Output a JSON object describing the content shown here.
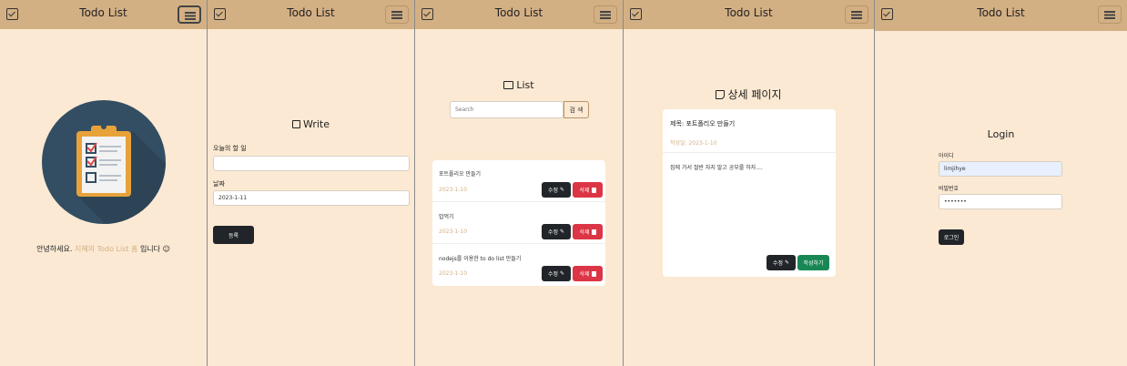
{
  "app_title": "Todo List",
  "home": {
    "greeting_prefix": "안녕하세요. ",
    "greeting_name": "지혜의 Todo List 홈",
    "greeting_suffix": " 입니다 ☺"
  },
  "write": {
    "heading": "Write",
    "todo_label": "오늘의 할 일",
    "todo_value": "",
    "date_label": "날짜",
    "date_value": "2023-1-11",
    "submit_label": "등록"
  },
  "list": {
    "heading": "List",
    "search_placeholder": "Search",
    "search_button": "검 색",
    "edit_label": "수정",
    "delete_label": "삭제",
    "items": [
      {
        "title": "포트폴리오 만들기",
        "date": "2023-1-10"
      },
      {
        "title": "밥먹기",
        "date": "2023-1-10"
      },
      {
        "title": "nodejs를 이용한 to do list 만들기",
        "date": "2023-1-10"
      }
    ]
  },
  "detail": {
    "heading": "상세 페이지",
    "title_text": "제목: 포트폴리오 만들기",
    "date_text": "작성일: 2023-1-10",
    "body_text": "집에 가서 절반 자지 말고 공부를 하자....",
    "edit_label": "수정",
    "write_label": "작성하기"
  },
  "login": {
    "heading": "Login",
    "id_label": "아이디",
    "id_value": "limjihye",
    "password_label": "비밀번호",
    "password_value": "•••••••",
    "submit_label": "로그인"
  },
  "colors": {
    "nav": "#d3b084",
    "background": "#fbe9d3",
    "accent_text": "#d3b084",
    "danger": "#dc3545",
    "success": "#198754",
    "dark": "#212529"
  }
}
